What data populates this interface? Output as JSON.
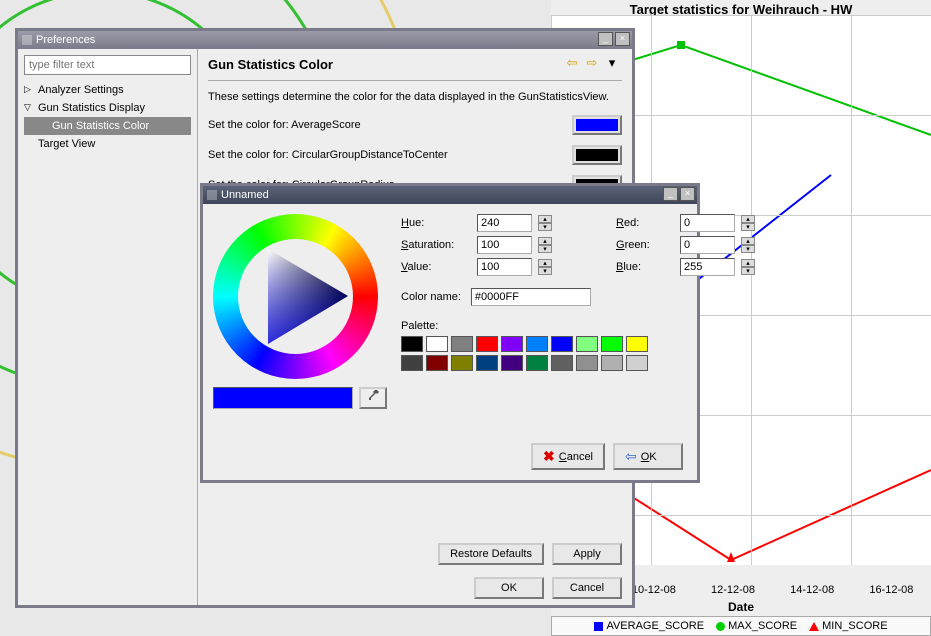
{
  "background": {
    "chart_title": "Target statistics for Weihrauch - HW",
    "xlabel": "Date",
    "xticks": [
      "12-08",
      "10-12-08",
      "12-12-08",
      "14-12-08",
      "16-12-08"
    ],
    "legend": [
      {
        "name": "AVERAGE_SCORE",
        "shape": "square",
        "color": "#0000ff"
      },
      {
        "name": "MAX_SCORE",
        "shape": "circle",
        "color": "#00d000"
      },
      {
        "name": "MIN_SCORE",
        "shape": "triangle",
        "color": "#ff0000"
      }
    ]
  },
  "chart_data": {
    "type": "line",
    "title": "Target statistics for Weihrauch - HW",
    "xlabel": "Date",
    "categories": [
      "12-08",
      "10-12-08",
      "12-12-08",
      "14-12-08",
      "16-12-08"
    ],
    "series": [
      {
        "name": "AVERAGE_SCORE",
        "color": "#0000ff",
        "values": [
          null,
          null,
          60,
          null,
          null
        ]
      },
      {
        "name": "MAX_SCORE",
        "color": "#00d000",
        "values": [
          null,
          95,
          null,
          null,
          null
        ]
      },
      {
        "name": "MIN_SCORE",
        "color": "#ff0000",
        "values": [
          null,
          null,
          10,
          null,
          null
        ]
      }
    ],
    "ylim": [
      0,
      100
    ]
  },
  "prefs": {
    "title": "Preferences",
    "filter_placeholder": "type filter text",
    "tree": {
      "analyzer": "Analyzer Settings",
      "display": "Gun Statistics Display",
      "display_color": "Gun Statistics Color",
      "target": "Target View"
    },
    "heading": "Gun Statistics Color",
    "description": "These settings determine the color for the data displayed in the GunStatisticsView.",
    "settings": [
      {
        "label": "Set the color for: AverageScore",
        "color": "#0000ff"
      },
      {
        "label": "Set the color for: CircularGroupDistanceToCenter",
        "color": "#000000"
      },
      {
        "label": "Set the color for: CircularGroupRadius",
        "color": "#000000"
      }
    ],
    "restore": "Restore Defaults",
    "apply": "Apply",
    "ok": "OK",
    "cancel": "Cancel"
  },
  "picker": {
    "title": "Unnamed",
    "hue_label": "Hue:",
    "sat_label": "Saturation:",
    "val_label": "Value:",
    "red_label": "Red:",
    "green_label": "Green:",
    "blue_label": "Blue:",
    "hue": "240",
    "sat": "100",
    "val": "100",
    "red": "0",
    "green": "0",
    "blue": "255",
    "cname_label": "Color name:",
    "cname": "#0000FF",
    "palette_label": "Palette:",
    "preview_color": "#0000ff",
    "palette_colors": [
      "#000000",
      "#ffffff",
      "#808080",
      "#ff0000",
      "#8000ff",
      "#0080ff",
      "#0000ff",
      "#80ff80",
      "#00ff00",
      "#ffff00",
      "#404040",
      "#800000",
      "#808000",
      "#004080",
      "#400080",
      "#008040",
      "#606060",
      "#909090",
      "#b0b0b0",
      "#d0d0d0"
    ],
    "cancel": "Cancel",
    "ok": "OK"
  }
}
